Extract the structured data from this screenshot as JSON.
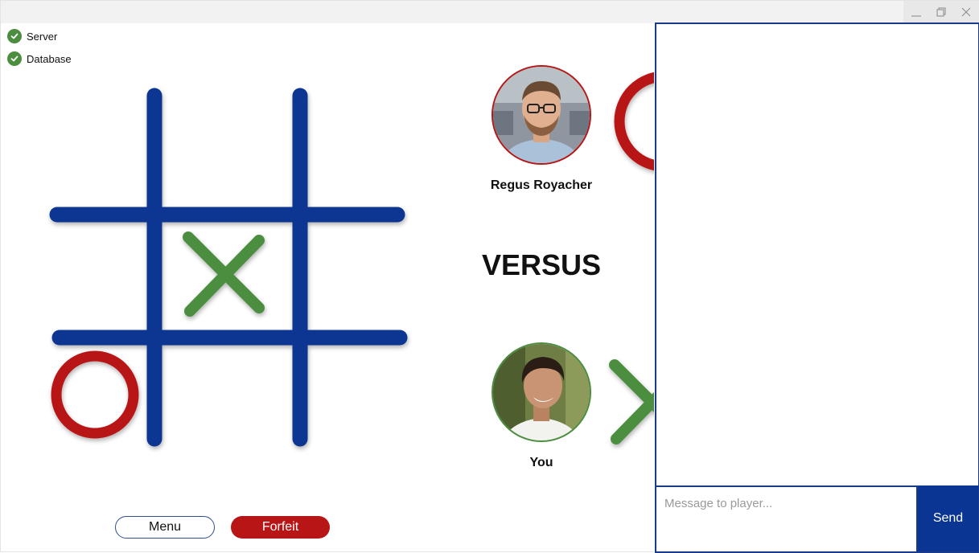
{
  "status": {
    "items": [
      {
        "label": "Server",
        "state": "ok"
      },
      {
        "label": "Database",
        "state": "ok"
      }
    ]
  },
  "board": {
    "cells": [
      "",
      "",
      "",
      "",
      "X",
      "",
      "O",
      "",
      ""
    ],
    "grid_color": "#0a3592",
    "x_color": "#4b8e3f",
    "o_color": "#b81616"
  },
  "opponent": {
    "name": "Regus Royacher",
    "marker": "O",
    "ring_color": "#b81616"
  },
  "versus_label": "VERSUS",
  "me": {
    "name": "You",
    "marker": "X",
    "ring_color": "#4b8e3f"
  },
  "buttons": {
    "menu_label": "Menu",
    "forfeit_label": "Forfeit"
  },
  "chat": {
    "placeholder": "Message to player...",
    "send_label": "Send",
    "messages": []
  },
  "window": {
    "minimize_icon": "minimize-icon",
    "maximize_icon": "maximize-icon",
    "close_icon": "close-icon"
  }
}
